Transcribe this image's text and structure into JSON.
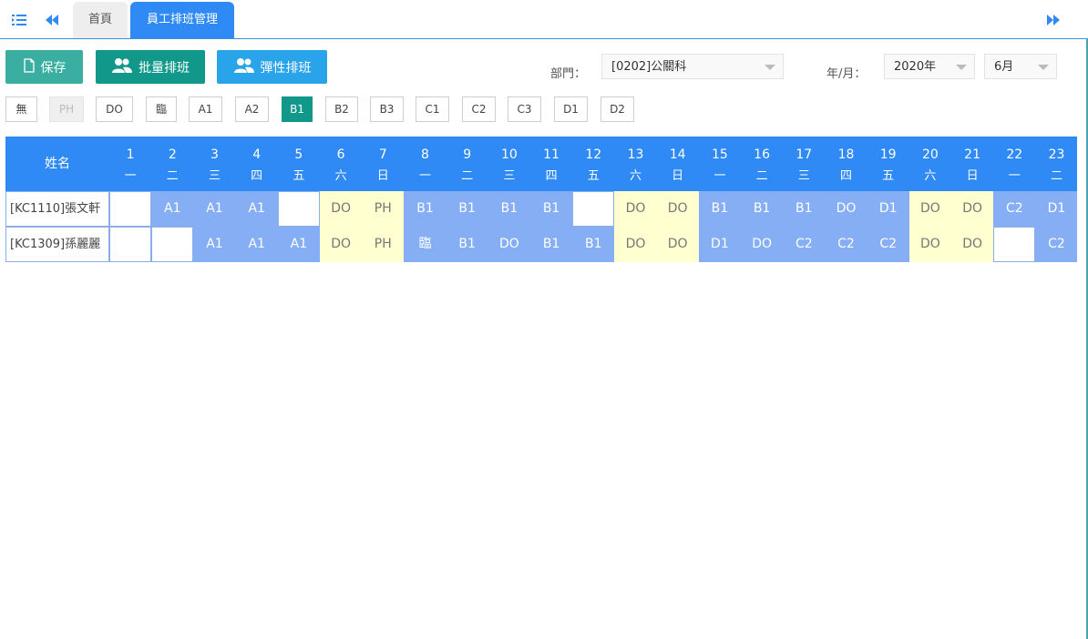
{
  "tabs": [
    {
      "label": "首頁",
      "active": false
    },
    {
      "label": "員工排班管理",
      "active": true
    }
  ],
  "toolbar": {
    "save_label": "保存",
    "batch_label": "批量排班",
    "flex_label": "彈性排班"
  },
  "filters": {
    "dept_label": "部門：",
    "dept_value": "[0202]公關科",
    "ym_label": "年/月：",
    "year_value": "2020年",
    "month_value": "6月"
  },
  "codes": [
    {
      "label": "無",
      "state": "normal"
    },
    {
      "label": "PH",
      "state": "disabled"
    },
    {
      "label": "DO",
      "state": "normal"
    },
    {
      "label": "臨",
      "state": "normal"
    },
    {
      "label": "A1",
      "state": "normal"
    },
    {
      "label": "A2",
      "state": "normal"
    },
    {
      "label": "B1",
      "state": "selected"
    },
    {
      "label": "B2",
      "state": "normal"
    },
    {
      "label": "B3",
      "state": "normal"
    },
    {
      "label": "C1",
      "state": "normal"
    },
    {
      "label": "C2",
      "state": "normal"
    },
    {
      "label": "C3",
      "state": "normal"
    },
    {
      "label": "D1",
      "state": "normal"
    },
    {
      "label": "D2",
      "state": "normal"
    }
  ],
  "schedule": {
    "name_header": "姓名",
    "days": [
      {
        "d": "1",
        "w": "一"
      },
      {
        "d": "2",
        "w": "二"
      },
      {
        "d": "3",
        "w": "三"
      },
      {
        "d": "4",
        "w": "四"
      },
      {
        "d": "5",
        "w": "五"
      },
      {
        "d": "6",
        "w": "六"
      },
      {
        "d": "7",
        "w": "日"
      },
      {
        "d": "8",
        "w": "一"
      },
      {
        "d": "9",
        "w": "二"
      },
      {
        "d": "10",
        "w": "三"
      },
      {
        "d": "11",
        "w": "四"
      },
      {
        "d": "12",
        "w": "五"
      },
      {
        "d": "13",
        "w": "六"
      },
      {
        "d": "14",
        "w": "日"
      },
      {
        "d": "15",
        "w": "一"
      },
      {
        "d": "16",
        "w": "二"
      },
      {
        "d": "17",
        "w": "三"
      },
      {
        "d": "18",
        "w": "四"
      },
      {
        "d": "19",
        "w": "五"
      },
      {
        "d": "20",
        "w": "六"
      },
      {
        "d": "21",
        "w": "日"
      },
      {
        "d": "22",
        "w": "一"
      },
      {
        "d": "23",
        "w": "二"
      }
    ],
    "rows": [
      {
        "name": "[KC1110]張文軒",
        "cells": [
          "",
          "A1",
          "A1",
          "A1",
          "",
          "DO",
          "PH",
          "B1",
          "B1",
          "B1",
          "B1",
          "",
          "DO",
          "DO",
          "B1",
          "B1",
          "B1",
          "DO",
          "D1",
          "DO",
          "DO",
          "C2",
          "D1"
        ],
        "types": [
          "e",
          "s",
          "s",
          "s",
          "e",
          "o",
          "o",
          "s",
          "s",
          "s",
          "s",
          "e",
          "o",
          "o",
          "s",
          "s",
          "s",
          "s",
          "s",
          "o",
          "o",
          "s",
          "s"
        ]
      },
      {
        "name": "[KC1309]孫麗麗",
        "cells": [
          "",
          "",
          "A1",
          "A1",
          "A1",
          "DO",
          "PH",
          "臨",
          "B1",
          "DO",
          "B1",
          "B1",
          "DO",
          "DO",
          "D1",
          "DO",
          "C2",
          "C2",
          "C2",
          "DO",
          "DO",
          "",
          "C2"
        ],
        "types": [
          "e",
          "e",
          "s",
          "s",
          "s",
          "o",
          "o",
          "s",
          "s",
          "s",
          "s",
          "s",
          "o",
          "o",
          "s",
          "s",
          "s",
          "s",
          "s",
          "o",
          "o",
          "e",
          "s"
        ]
      }
    ]
  },
  "colors": {
    "tab_active": "#2f8af5",
    "header": "#2f8af5",
    "shift_cell": "#85aef5",
    "off_cell": "#ffffd0",
    "save_button": "#3aaea0",
    "batch_button": "#12988a",
    "flex_button": "#29a3ea"
  }
}
